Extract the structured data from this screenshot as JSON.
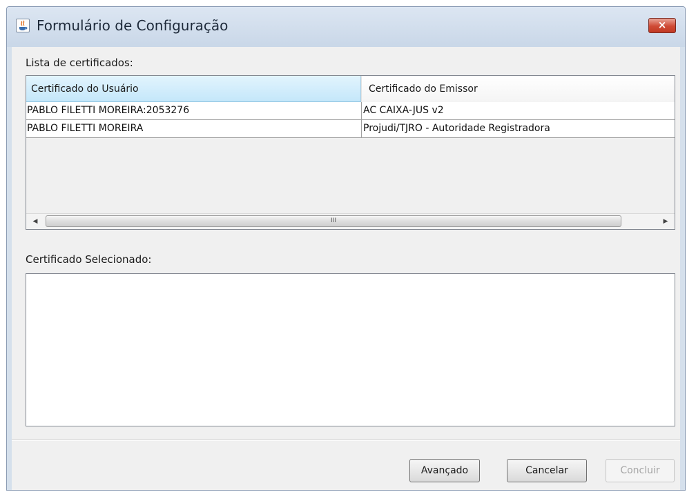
{
  "window": {
    "title": "Formulário de Configuração",
    "close_label": "×"
  },
  "certificates": {
    "list_label": "Lista de certificados:",
    "columns": [
      "Certificado do Usuário",
      "Certificado do Emissor"
    ],
    "rows": [
      [
        "PABLO FILETTI MOREIRA:2053276",
        "AC CAIXA-JUS v2"
      ],
      [
        "PABLO FILETTI MOREIRA",
        "Projudi/TJRO - Autoridade Registradora"
      ]
    ],
    "scroll_grip": "III"
  },
  "selected": {
    "label": "Certificado Selecionado:",
    "value": ""
  },
  "buttons": {
    "advanced": "Avançado",
    "cancel": "Cancelar",
    "finish": "Concluir"
  },
  "colors": {
    "header_selected": "#c4e7fa",
    "close_button": "#cf4a35",
    "disabled_text": "#a6a6a6"
  }
}
